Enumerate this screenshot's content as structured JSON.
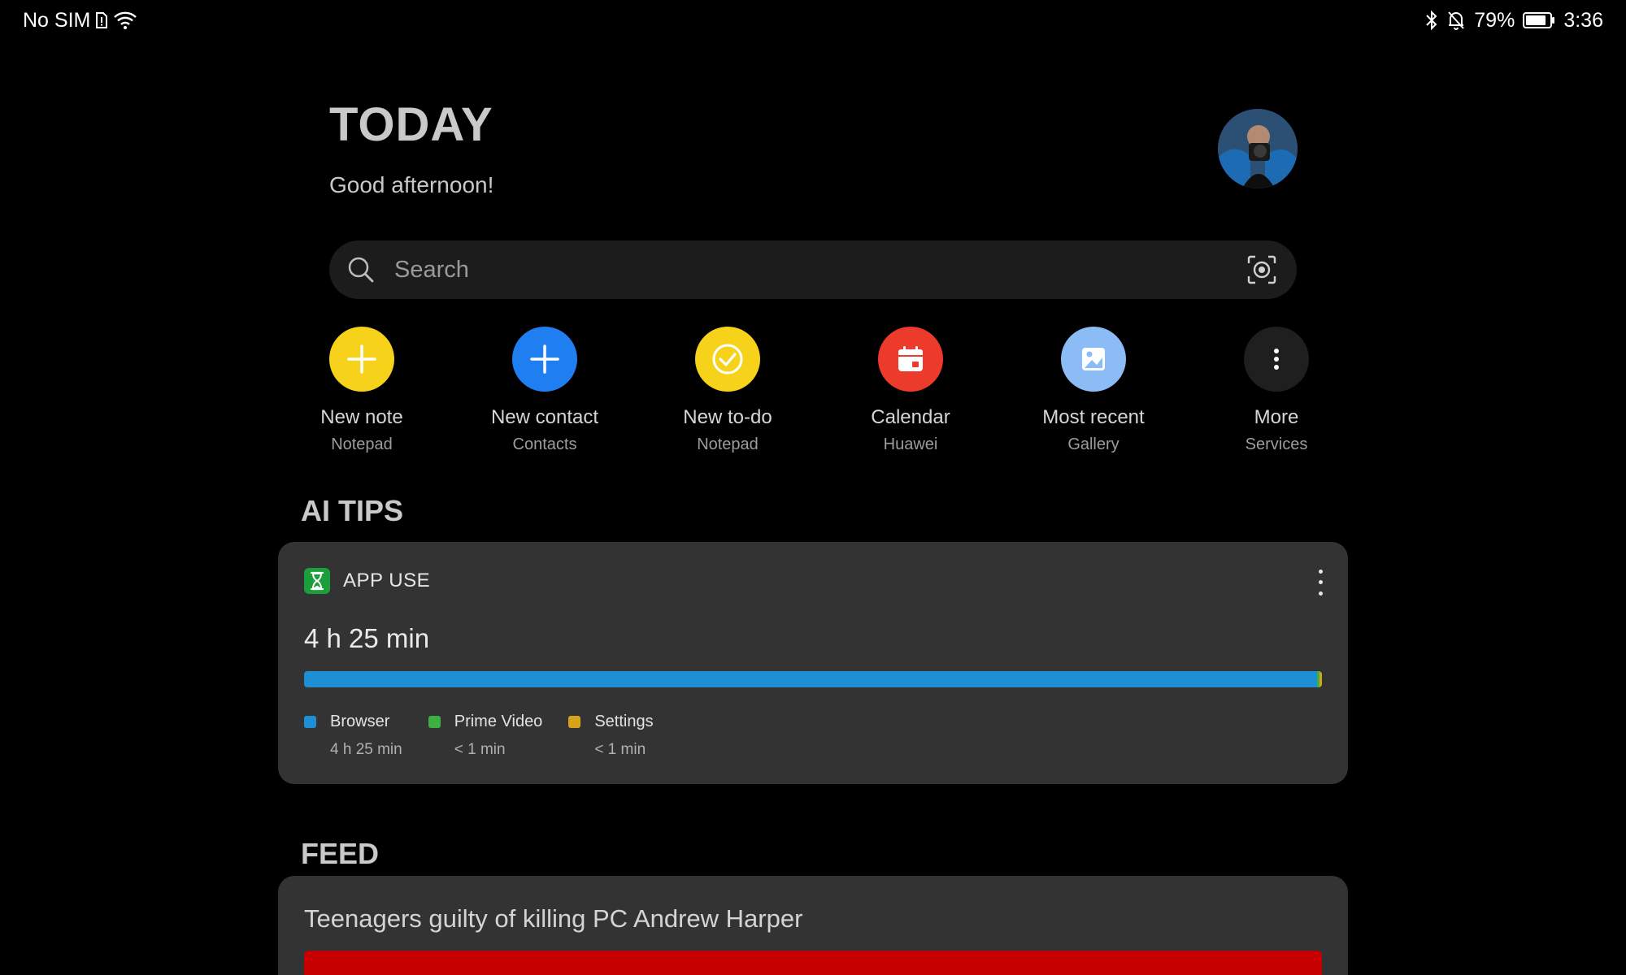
{
  "status_bar": {
    "carrier": "No SIM",
    "battery_percent": "79%",
    "time": "3:36"
  },
  "header": {
    "title": "TODAY",
    "greeting": "Good afternoon!"
  },
  "search": {
    "placeholder": "Search"
  },
  "quick_actions": [
    {
      "label": "New note",
      "sub": "Notepad",
      "icon": "plus-icon",
      "color": "#f7d21b"
    },
    {
      "label": "New contact",
      "sub": "Contacts",
      "icon": "plus-icon",
      "color": "#1f7ff0"
    },
    {
      "label": "New to-do",
      "sub": "Notepad",
      "icon": "check-icon",
      "color": "#f7d21b"
    },
    {
      "label": "Calendar",
      "sub": "Huawei",
      "icon": "calendar-icon",
      "color": "#ec3a2b"
    },
    {
      "label": "Most recent",
      "sub": "Gallery",
      "icon": "gallery-icon",
      "color": "#8cbcf5"
    },
    {
      "label": "More",
      "sub": "Services",
      "icon": "more-vertical-icon",
      "color": "#1f1f1f"
    }
  ],
  "ai_tips": {
    "heading": "AI TIPS",
    "card_title": "APP USE",
    "total": "4 h 25 min",
    "apps": [
      {
        "name": "Browser",
        "value": "4 h 25 min",
        "color": "#1e8fd4",
        "share": 0.996
      },
      {
        "name": "Prime Video",
        "value": "< 1 min",
        "color": "#3cb043",
        "share": 0.002
      },
      {
        "name": "Settings",
        "value": "< 1 min",
        "color": "#d9a21c",
        "share": 0.002
      }
    ]
  },
  "feed": {
    "heading": "FEED",
    "headline": "Teenagers guilty of killing PC Andrew Harper"
  },
  "colors": {
    "background": "#000000",
    "card": "#333333",
    "feed_image": "#c60000"
  }
}
